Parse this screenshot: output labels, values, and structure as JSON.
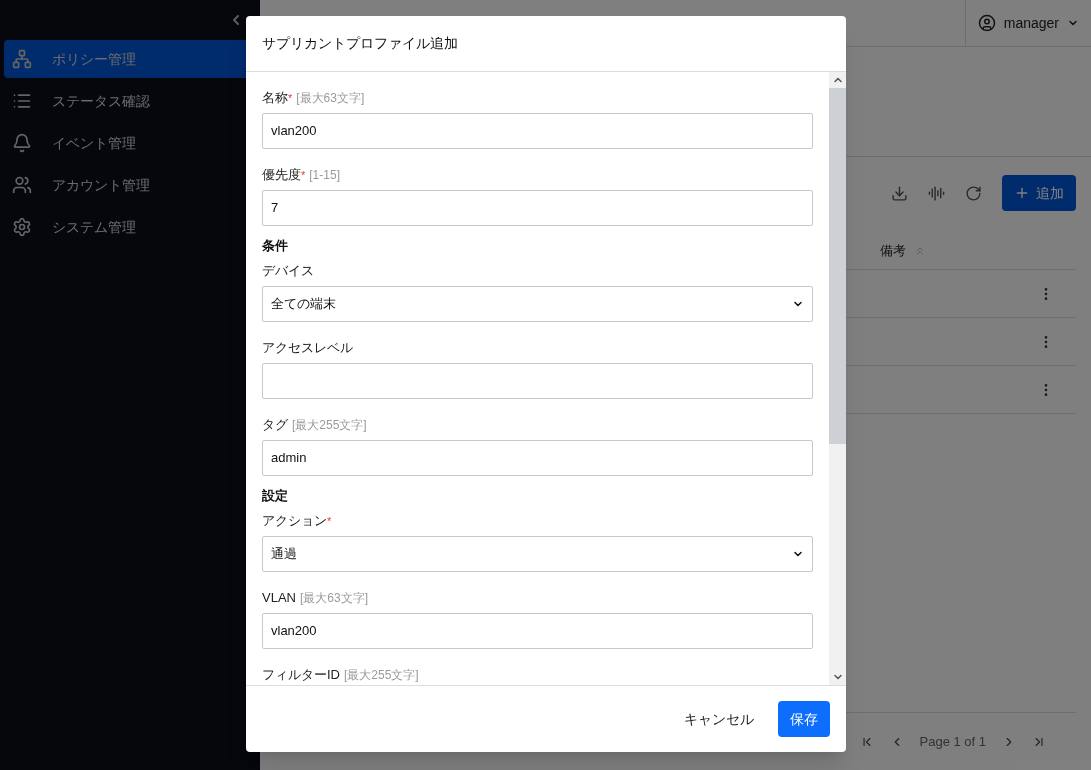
{
  "sidebar": {
    "items": [
      {
        "label": "ポリシー管理",
        "kind": "policy",
        "selected": true
      },
      {
        "label": "ステータス確認",
        "kind": "list",
        "selected": false
      },
      {
        "label": "イベント管理",
        "kind": "bell",
        "selected": false
      },
      {
        "label": "アカウント管理",
        "kind": "people",
        "selected": false
      },
      {
        "label": "システム管理",
        "kind": "gear",
        "selected": false
      }
    ]
  },
  "header": {
    "user": "manager"
  },
  "toolbar": {
    "add_button": "追加"
  },
  "table": {
    "columns": [
      "備考"
    ]
  },
  "pagination": {
    "label": "Page 1 of 1"
  },
  "dialog": {
    "title": "サプリカントプロファイル追加",
    "fields": [
      {
        "kind": "text",
        "label": "名称",
        "required_mark": "*",
        "hint": "[最大63文字]",
        "value": "vlan200"
      },
      {
        "kind": "text",
        "label": "優先度",
        "required_mark": "*",
        "hint": "[1-15]",
        "value": "7"
      },
      {
        "kind": "heading",
        "label": "条件"
      },
      {
        "kind": "select",
        "label": "デバイス",
        "value": "全ての端末"
      },
      {
        "kind": "text",
        "label": "アクセスレベル"
      },
      {
        "kind": "text",
        "label": "タグ",
        "hint": "[最大255文字]",
        "value": "admin"
      },
      {
        "kind": "heading",
        "label": "設定"
      },
      {
        "kind": "select",
        "label": "アクション",
        "required_mark": "*",
        "value": "通過"
      },
      {
        "kind": "text",
        "label": "VLAN",
        "hint": "[最大63文字]",
        "value": "vlan200"
      },
      {
        "kind": "cut",
        "label": "フィルターID",
        "hint": "[最大255文字]"
      }
    ],
    "buttons": {
      "cancel": "キャンセル",
      "save": "保存"
    }
  }
}
